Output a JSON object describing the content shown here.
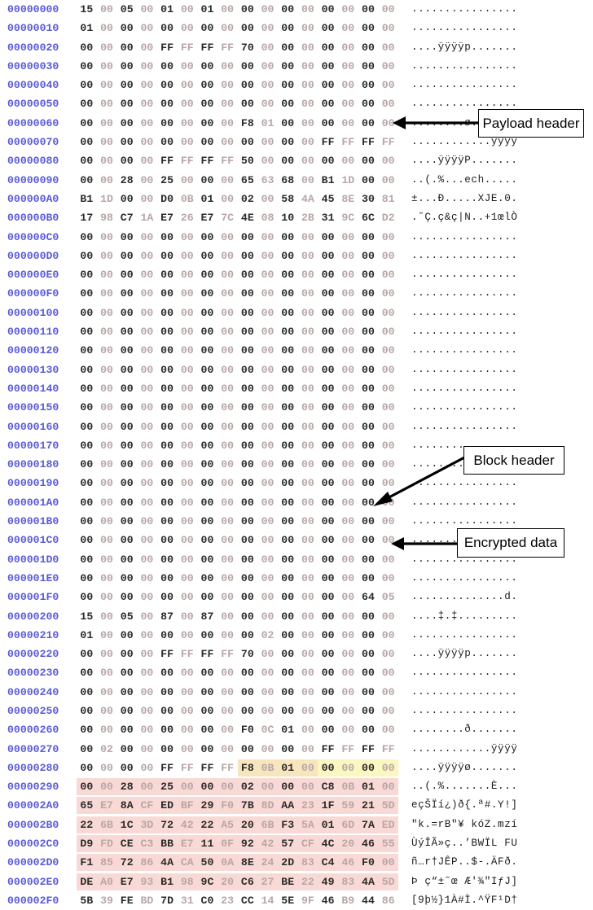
{
  "viewer": {
    "name": "hex-dump-view",
    "address_color": "#5b5bd6",
    "byte_dark_color": "#2b2b2b",
    "byte_light_color": "#b9a6a6",
    "background": "#ffffff"
  },
  "highlight_colors": {
    "blue": "#ccd8ec",
    "yellow": "#fbf7c0",
    "green": "#cfdcc2",
    "purple": "#e8dff0",
    "orange": "#f7e6bd",
    "pink": "#f9d9d6"
  },
  "rows": [
    {
      "addr": "00000000",
      "bytes": [
        "15",
        "00",
        "05",
        "00",
        "01",
        "00",
        "01",
        "00",
        "00",
        "00",
        "00",
        "00",
        "00",
        "00",
        "00",
        "00"
      ],
      "ascii": "................"
    },
    {
      "addr": "00000010",
      "bytes": [
        "01",
        "00",
        "00",
        "00",
        "00",
        "00",
        "00",
        "00",
        "00",
        "00",
        "00",
        "00",
        "00",
        "00",
        "00",
        "00"
      ],
      "ascii": "................"
    },
    {
      "addr": "00000020",
      "bytes": [
        "00",
        "00",
        "00",
        "00",
        "FF",
        "FF",
        "FF",
        "FF",
        "70",
        "00",
        "00",
        "00",
        "00",
        "00",
        "00",
        "00"
      ],
      "ascii": "....ÿÿÿÿp......."
    },
    {
      "addr": "00000030",
      "bytes": [
        "00",
        "00",
        "00",
        "00",
        "00",
        "00",
        "00",
        "00",
        "00",
        "00",
        "00",
        "00",
        "00",
        "00",
        "00",
        "00"
      ],
      "ascii": "................"
    },
    {
      "addr": "00000040",
      "bytes": [
        "00",
        "00",
        "00",
        "00",
        "00",
        "00",
        "00",
        "00",
        "00",
        "00",
        "00",
        "00",
        "00",
        "00",
        "00",
        "00"
      ],
      "ascii": "................"
    },
    {
      "addr": "00000050",
      "bytes": [
        "00",
        "00",
        "00",
        "00",
        "00",
        "00",
        "00",
        "00",
        "00",
        "00",
        "00",
        "00",
        "00",
        "00",
        "00",
        "00"
      ],
      "ascii": "................"
    },
    {
      "addr": "00000060",
      "bytes": [
        "00",
        "00",
        "00",
        "00",
        "00",
        "00",
        "00",
        "00",
        "F8",
        "01",
        "00",
        "00",
        "00",
        "00",
        "00",
        "00"
      ],
      "ascii": "........ø......."
    },
    {
      "addr": "00000070",
      "bytes": [
        "00",
        "00",
        "00",
        "00",
        "00",
        "00",
        "00",
        "00",
        "00",
        "00",
        "00",
        "00",
        "FF",
        "FF",
        "FF",
        "FF"
      ],
      "ascii": "............ÿÿÿÿ"
    },
    {
      "addr": "00000080",
      "bytes": [
        "00",
        "00",
        "00",
        "00",
        "FF",
        "FF",
        "FF",
        "FF",
        "50",
        "00",
        "00",
        "00",
        "00",
        "00",
        "00",
        "00"
      ],
      "ascii": "....ÿÿÿÿP......."
    },
    {
      "addr": "00000090",
      "bytes": [
        "00",
        "00",
        "28",
        "00",
        "25",
        "00",
        "00",
        "00",
        "65",
        "63",
        "68",
        "00",
        "B1",
        "1D",
        "00",
        "00"
      ],
      "ascii": "..(.%...ech....."
    },
    {
      "addr": "000000A0",
      "bytes": [
        "B1",
        "1D",
        "00",
        "00",
        "D0",
        "0B",
        "01",
        "00",
        "02",
        "00",
        "58",
        "4A",
        "45",
        "8E",
        "30",
        "81"
      ],
      "ascii": "±...Ð.....XJE.0."
    },
    {
      "addr": "000000B0",
      "bytes": [
        "17",
        "98",
        "C7",
        "1A",
        "E7",
        "26",
        "E7",
        "7C",
        "4E",
        "08",
        "10",
        "2B",
        "31",
        "9C",
        "6C",
        "D2"
      ],
      "ascii": ".˜Ç.ç&ç|N..+1œlÒ"
    },
    {
      "addr": "000000C0",
      "bytes": [
        "00",
        "00",
        "00",
        "00",
        "00",
        "00",
        "00",
        "00",
        "00",
        "00",
        "00",
        "00",
        "00",
        "00",
        "00",
        "00"
      ],
      "ascii": "................"
    },
    {
      "addr": "000000D0",
      "bytes": [
        "00",
        "00",
        "00",
        "00",
        "00",
        "00",
        "00",
        "00",
        "00",
        "00",
        "00",
        "00",
        "00",
        "00",
        "00",
        "00"
      ],
      "ascii": "................"
    },
    {
      "addr": "000000E0",
      "bytes": [
        "00",
        "00",
        "00",
        "00",
        "00",
        "00",
        "00",
        "00",
        "00",
        "00",
        "00",
        "00",
        "00",
        "00",
        "00",
        "00"
      ],
      "ascii": "................"
    },
    {
      "addr": "000000F0",
      "bytes": [
        "00",
        "00",
        "00",
        "00",
        "00",
        "00",
        "00",
        "00",
        "00",
        "00",
        "00",
        "00",
        "00",
        "00",
        "00",
        "00"
      ],
      "ascii": "................"
    },
    {
      "addr": "00000100",
      "bytes": [
        "00",
        "00",
        "00",
        "00",
        "00",
        "00",
        "00",
        "00",
        "00",
        "00",
        "00",
        "00",
        "00",
        "00",
        "00",
        "00"
      ],
      "ascii": "................"
    },
    {
      "addr": "00000110",
      "bytes": [
        "00",
        "00",
        "00",
        "00",
        "00",
        "00",
        "00",
        "00",
        "00",
        "00",
        "00",
        "00",
        "00",
        "00",
        "00",
        "00"
      ],
      "ascii": "................"
    },
    {
      "addr": "00000120",
      "bytes": [
        "00",
        "00",
        "00",
        "00",
        "00",
        "00",
        "00",
        "00",
        "00",
        "00",
        "00",
        "00",
        "00",
        "00",
        "00",
        "00"
      ],
      "ascii": "................"
    },
    {
      "addr": "00000130",
      "bytes": [
        "00",
        "00",
        "00",
        "00",
        "00",
        "00",
        "00",
        "00",
        "00",
        "00",
        "00",
        "00",
        "00",
        "00",
        "00",
        "00"
      ],
      "ascii": "................"
    },
    {
      "addr": "00000140",
      "bytes": [
        "00",
        "00",
        "00",
        "00",
        "00",
        "00",
        "00",
        "00",
        "00",
        "00",
        "00",
        "00",
        "00",
        "00",
        "00",
        "00"
      ],
      "ascii": "................"
    },
    {
      "addr": "00000150",
      "bytes": [
        "00",
        "00",
        "00",
        "00",
        "00",
        "00",
        "00",
        "00",
        "00",
        "00",
        "00",
        "00",
        "00",
        "00",
        "00",
        "00"
      ],
      "ascii": "................"
    },
    {
      "addr": "00000160",
      "bytes": [
        "00",
        "00",
        "00",
        "00",
        "00",
        "00",
        "00",
        "00",
        "00",
        "00",
        "00",
        "00",
        "00",
        "00",
        "00",
        "00"
      ],
      "ascii": "................"
    },
    {
      "addr": "00000170",
      "bytes": [
        "00",
        "00",
        "00",
        "00",
        "00",
        "00",
        "00",
        "00",
        "00",
        "00",
        "00",
        "00",
        "00",
        "00",
        "00",
        "00"
      ],
      "ascii": "................"
    },
    {
      "addr": "00000180",
      "bytes": [
        "00",
        "00",
        "00",
        "00",
        "00",
        "00",
        "00",
        "00",
        "00",
        "00",
        "00",
        "00",
        "00",
        "00",
        "00",
        "00"
      ],
      "ascii": "................"
    },
    {
      "addr": "00000190",
      "bytes": [
        "00",
        "00",
        "00",
        "00",
        "00",
        "00",
        "00",
        "00",
        "00",
        "00",
        "00",
        "00",
        "00",
        "00",
        "00",
        "00"
      ],
      "ascii": "................"
    },
    {
      "addr": "000001A0",
      "bytes": [
        "00",
        "00",
        "00",
        "00",
        "00",
        "00",
        "00",
        "00",
        "00",
        "00",
        "00",
        "00",
        "00",
        "00",
        "00",
        "00"
      ],
      "ascii": "................"
    },
    {
      "addr": "000001B0",
      "bytes": [
        "00",
        "00",
        "00",
        "00",
        "00",
        "00",
        "00",
        "00",
        "00",
        "00",
        "00",
        "00",
        "00",
        "00",
        "00",
        "00"
      ],
      "ascii": "................"
    },
    {
      "addr": "000001C0",
      "bytes": [
        "00",
        "00",
        "00",
        "00",
        "00",
        "00",
        "00",
        "00",
        "00",
        "00",
        "00",
        "00",
        "00",
        "00",
        "00",
        "00"
      ],
      "ascii": "................"
    },
    {
      "addr": "000001D0",
      "bytes": [
        "00",
        "00",
        "00",
        "00",
        "00",
        "00",
        "00",
        "00",
        "00",
        "00",
        "00",
        "00",
        "00",
        "00",
        "00",
        "00"
      ],
      "ascii": "................"
    },
    {
      "addr": "000001E0",
      "bytes": [
        "00",
        "00",
        "00",
        "00",
        "00",
        "00",
        "00",
        "00",
        "00",
        "00",
        "00",
        "00",
        "00",
        "00",
        "00",
        "00"
      ],
      "ascii": "................"
    },
    {
      "addr": "000001F0",
      "bytes": [
        "00",
        "00",
        "00",
        "00",
        "00",
        "00",
        "00",
        "00",
        "00",
        "00",
        "00",
        "00",
        "00",
        "00",
        "64",
        "05"
      ],
      "ascii": "..............d."
    },
    {
      "addr": "00000200",
      "bytes": [
        "15",
        "00",
        "05",
        "00",
        "87",
        "00",
        "87",
        "00",
        "00",
        "00",
        "00",
        "00",
        "00",
        "00",
        "00",
        "00"
      ],
      "ascii": "....‡.‡........."
    },
    {
      "addr": "00000210",
      "bytes": [
        "01",
        "00",
        "00",
        "00",
        "00",
        "00",
        "00",
        "00",
        "00",
        "02",
        "00",
        "00",
        "00",
        "00",
        "00",
        "00"
      ],
      "ascii": "................"
    },
    {
      "addr": "00000220",
      "bytes": [
        "00",
        "00",
        "00",
        "00",
        "FF",
        "FF",
        "FF",
        "FF",
        "70",
        "00",
        "00",
        "00",
        "00",
        "00",
        "00",
        "00"
      ],
      "ascii": "....ÿÿÿÿp......."
    },
    {
      "addr": "00000230",
      "bytes": [
        "00",
        "00",
        "00",
        "00",
        "00",
        "00",
        "00",
        "00",
        "00",
        "00",
        "00",
        "00",
        "00",
        "00",
        "00",
        "00"
      ],
      "ascii": "................"
    },
    {
      "addr": "00000240",
      "bytes": [
        "00",
        "00",
        "00",
        "00",
        "00",
        "00",
        "00",
        "00",
        "00",
        "00",
        "00",
        "00",
        "00",
        "00",
        "00",
        "00"
      ],
      "ascii": "................"
    },
    {
      "addr": "00000250",
      "bytes": [
        "00",
        "00",
        "00",
        "00",
        "00",
        "00",
        "00",
        "00",
        "00",
        "00",
        "00",
        "00",
        "00",
        "00",
        "00",
        "00"
      ],
      "ascii": "................"
    },
    {
      "addr": "00000260",
      "bytes": [
        "00",
        "00",
        "00",
        "00",
        "00",
        "00",
        "00",
        "00",
        "F0",
        "0C",
        "01",
        "00",
        "00",
        "00",
        "00",
        "00"
      ],
      "ascii": "........ð......."
    },
    {
      "addr": "00000270",
      "bytes": [
        "00",
        "02",
        "00",
        "00",
        "00",
        "00",
        "00",
        "00",
        "00",
        "00",
        "00",
        "00",
        "FF",
        "FF",
        "FF",
        "FF"
      ],
      "ascii": "............ÿÿÿÿ"
    },
    {
      "addr": "00000280",
      "bytes": [
        "00",
        "00",
        "00",
        "00",
        "FF",
        "FF",
        "FF",
        "FF",
        "F8",
        "0B",
        "01",
        "00",
        "00",
        "00",
        "00",
        "00"
      ],
      "ascii": "....ÿÿÿÿø......."
    },
    {
      "addr": "00000290",
      "bytes": [
        "00",
        "00",
        "28",
        "00",
        "25",
        "00",
        "00",
        "00",
        "02",
        "00",
        "00",
        "00",
        "C8",
        "0B",
        "01",
        "00"
      ],
      "ascii": "..(.%.......È..."
    },
    {
      "addr": "000002A0",
      "bytes": [
        "65",
        "E7",
        "8A",
        "CF",
        "ED",
        "BF",
        "29",
        "F0",
        "7B",
        "8D",
        "AA",
        "23",
        "1F",
        "59",
        "21",
        "5D"
      ],
      "ascii": "eçŠÏí¿)ð{.ª#.Y!]"
    },
    {
      "addr": "000002B0",
      "bytes": [
        "22",
        "6B",
        "1C",
        "3D",
        "72",
        "42",
        "22",
        "A5",
        "20",
        "6B",
        "F3",
        "5A",
        "01",
        "6D",
        "7A",
        "ED"
      ],
      "ascii": "\"k.=rB\"¥ kóZ.mzí"
    },
    {
      "addr": "000002C0",
      "bytes": [
        "D9",
        "FD",
        "CE",
        "C3",
        "BB",
        "E7",
        "11",
        "0F",
        "92",
        "42",
        "57",
        "CF",
        "4C",
        "20",
        "46",
        "55"
      ],
      "ascii": "ÙýÎÃ»ç..’BWÏL FU"
    },
    {
      "addr": "000002D0",
      "bytes": [
        "F1",
        "85",
        "72",
        "86",
        "4A",
        "CA",
        "50",
        "0A",
        "8E",
        "24",
        "2D",
        "83",
        "C4",
        "46",
        "F0",
        "00"
      ],
      "ascii": "ñ…r†JÊP..$-.ÄFð."
    },
    {
      "addr": "000002E0",
      "bytes": [
        "DE",
        "A0",
        "E7",
        "93",
        "B1",
        "98",
        "9C",
        "20",
        "C6",
        "27",
        "BE",
        "22",
        "49",
        "83",
        "4A",
        "5D"
      ],
      "ascii": "Þ ç“±˜œ Æ'¾\"IƒJ]"
    },
    {
      "addr": "000002F0",
      "bytes": [
        "5B",
        "39",
        "FE",
        "BD",
        "7D",
        "31",
        "C0",
        "23",
        "CC",
        "14",
        "5E",
        "9F",
        "46",
        "B9",
        "44",
        "86"
      ],
      "ascii": "[9þ½}1À#Ì.^ŸF¹D†"
    }
  ],
  "highlights": [
    {
      "name": "blue-field-ech",
      "row": 9,
      "start": 8,
      "count": 4,
      "color": "#ccd8ec"
    },
    {
      "name": "yellow-field-length",
      "row": 9,
      "start": 12,
      "count": 4,
      "color": "#fbf7c0"
    },
    {
      "name": "green-payload-header",
      "row": 10,
      "start": 0,
      "count": 10,
      "color": "#cfdcc2"
    },
    {
      "name": "purple-key-part-a",
      "row": 10,
      "start": 10,
      "count": 6,
      "color": "#e8dff0"
    },
    {
      "name": "purple-key-part-b",
      "row": 11,
      "start": 0,
      "count": 16,
      "color": "#e8dff0"
    },
    {
      "name": "orange-block-count",
      "row": 40,
      "start": 8,
      "count": 4,
      "color": "#f7e6bd"
    },
    {
      "name": "yellow-block-size",
      "row": 40,
      "start": 12,
      "count": 4,
      "color": "#fbf7c0"
    },
    {
      "name": "pink-encrypted-a",
      "row": 41,
      "start": 0,
      "count": 16,
      "color": "#f9d9d6"
    },
    {
      "name": "pink-encrypted-b",
      "row": 42,
      "start": 0,
      "count": 16,
      "color": "#f9d9d6"
    },
    {
      "name": "pink-encrypted-c",
      "row": 43,
      "start": 0,
      "count": 16,
      "color": "#f9d9d6"
    },
    {
      "name": "pink-encrypted-d",
      "row": 44,
      "start": 0,
      "count": 16,
      "color": "#f9d9d6"
    },
    {
      "name": "pink-encrypted-e",
      "row": 45,
      "start": 0,
      "count": 16,
      "color": "#f9d9d6"
    },
    {
      "name": "pink-encrypted-f",
      "row": 46,
      "start": 0,
      "count": 16,
      "color": "#f9d9d6"
    }
  ],
  "annotations": {
    "payload_header": {
      "label": "Payload header"
    },
    "block_header": {
      "label": "Block header"
    },
    "encrypted_data": {
      "label": "Encrypted data"
    }
  }
}
